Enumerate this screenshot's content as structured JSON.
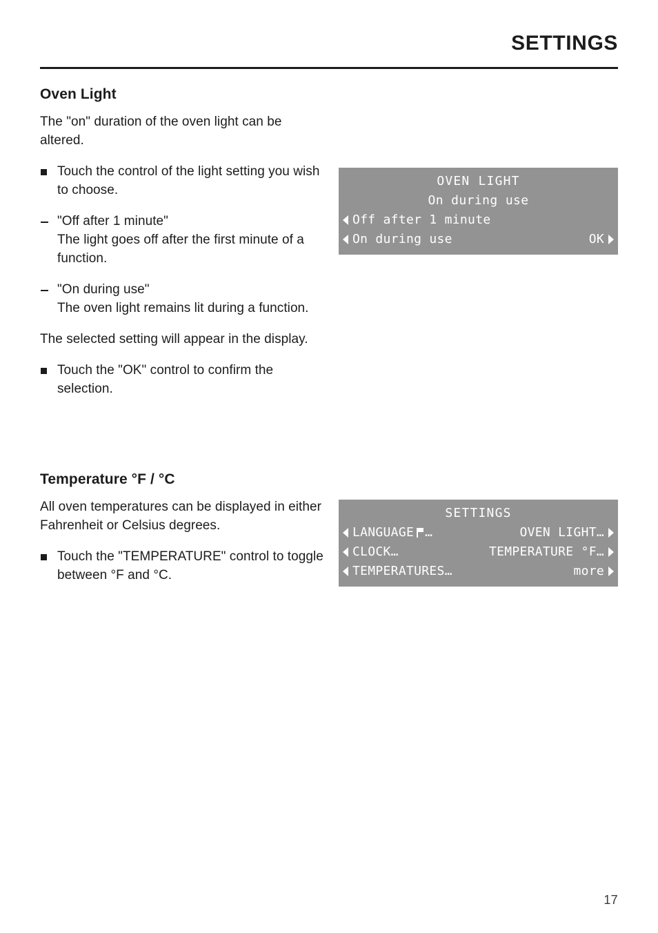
{
  "header": {
    "title": "SETTINGS"
  },
  "sections": [
    {
      "heading": "Oven Light",
      "intro": "The \"on\" duration of the oven light can be altered.",
      "items": [
        {
          "marker": "square",
          "text": "Touch the control of the light setting you wish to choose."
        },
        {
          "marker": "dash",
          "text": "\"Off after 1 minute\"\nThe light goes off after the first minute of a function."
        },
        {
          "marker": "dash",
          "text": "\"On during use\"\nThe oven light remains lit during a function."
        }
      ],
      "note": "The selected setting will appear in the display.",
      "final_item": {
        "marker": "square",
        "text": "Touch the \"OK\" control to confirm the selection."
      }
    },
    {
      "heading": "Temperature °F / °C",
      "intro": "All oven temperatures can be displayed in either Fahrenheit or Celsius degrees.",
      "item": {
        "marker": "square",
        "text": "Touch the \"TEMPERATURE\" control to toggle between °F and °C."
      }
    }
  ],
  "displays": {
    "oven_light": {
      "title": "OVEN LIGHT",
      "subtitle": "On during use",
      "rows": [
        {
          "left_arrow": "left-triangle-icon",
          "label": "Off after 1 minute",
          "right_label": "",
          "right_arrow": ""
        },
        {
          "left_arrow": "left-triangle-icon",
          "label": "On during use",
          "right_label": "OK",
          "right_arrow": "right-triangle-icon"
        }
      ]
    },
    "settings_menu": {
      "title": "SETTINGS",
      "rows": [
        {
          "left_arrow": "left-triangle-icon",
          "label": "LANGUAGE",
          "label_icon": "flag-icon",
          "label_suffix": "…",
          "right_label": "OVEN LIGHT…",
          "right_arrow": "right-triangle-icon"
        },
        {
          "left_arrow": "left-triangle-icon",
          "label": "CLOCK…",
          "label_icon": "",
          "label_suffix": "",
          "right_label": "TEMPERATURE °F…",
          "right_arrow": "right-triangle-icon"
        },
        {
          "left_arrow": "left-triangle-icon",
          "label": "TEMPERATURES…",
          "label_icon": "",
          "label_suffix": "",
          "right_label": "more",
          "right_arrow": "right-triangle-icon"
        }
      ]
    }
  },
  "footer": {
    "page_number": "17"
  },
  "colors": {
    "lcd_background": "#939393",
    "lcd_text": "#ffffff",
    "body_text": "#1c1c1c"
  }
}
